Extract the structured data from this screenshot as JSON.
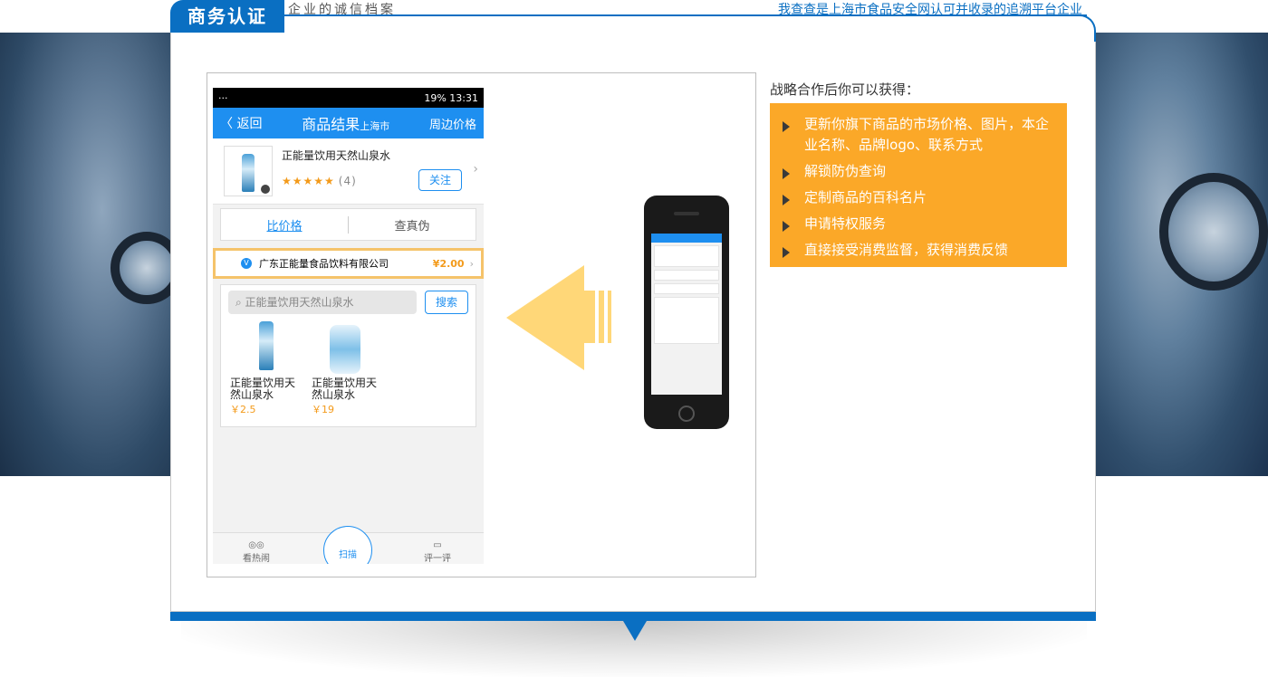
{
  "header": {
    "badge": "商务认证",
    "subtitle": "企业的诚信档案",
    "link": "我查查是上海市食品安全网认可并收录的追溯平台企业"
  },
  "phone_screen": {
    "status": {
      "left": "···",
      "right": "19% 13:31"
    },
    "appbar": {
      "back": "〈 返回",
      "title": "商品结果",
      "city": "上海市",
      "nearby": "周边价格"
    },
    "product": {
      "name": "正能量饮用天然山泉水",
      "stars": "★★★★★",
      "rating_count": "(4)",
      "follow": "关注"
    },
    "tabs": {
      "compare": "比价格",
      "verify": "查真伪"
    },
    "seller": {
      "badge": "V",
      "name": "广东正能量食品饮料有限公司",
      "price": "¥2.00"
    },
    "search": {
      "placeholder": "正能量饮用天然山泉水",
      "button": "搜索"
    },
    "results": [
      {
        "name": "正能量饮用天然山泉水",
        "price": "￥2.5"
      },
      {
        "name": "正能量饮用天然山泉水",
        "price": "￥19"
      }
    ],
    "tabbar": {
      "left": "看热闹",
      "center": "扫描",
      "right": "评一评"
    }
  },
  "benefits": {
    "title": "战略合作后你可以获得：",
    "items": [
      "更新你旗下商品的市场价格、图片，本企业名称、品牌logo、联系方式",
      "解锁防伪查询",
      "定制商品的百科名片",
      "申请特权服务",
      "直接接受消费监督，获得消费反馈"
    ]
  },
  "colors": {
    "brand_blue": "#0a6fc2",
    "app_blue": "#1e8ff0",
    "orange": "#fba828",
    "arrow": "#ffd778"
  }
}
